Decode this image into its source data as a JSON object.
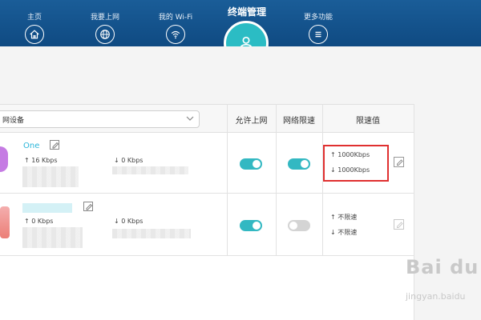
{
  "nav": {
    "items": [
      {
        "label": "主页",
        "icon": "home-icon"
      },
      {
        "label": "我要上网",
        "icon": "globe-icon"
      },
      {
        "label": "我的 Wi-Fi",
        "icon": "wifi-icon"
      },
      {
        "label": "终端管理",
        "icon": "user-icon",
        "active": true
      },
      {
        "label": "更多功能",
        "icon": "menu-icon"
      }
    ],
    "active_color": "#2bbcc4",
    "bar_color": "#1a5d98"
  },
  "table": {
    "filter_value": "网设备",
    "headers": {
      "allow": "允许上网",
      "limit": "网络限速",
      "limit_value": "限速值"
    },
    "rows": [
      {
        "name": "One",
        "up_speed": "↑ 16 Kbps",
        "down_speed": "↓ 0 Kbps",
        "allow_internet": true,
        "speed_limit": true,
        "up_limit": "↑ 1000Kbps",
        "down_limit": "↓ 1000Kbps",
        "highlighted": true
      },
      {
        "name": "",
        "up_speed": "↑ 0 Kbps",
        "down_speed": "↓ 0 Kbps",
        "allow_internet": true,
        "speed_limit": false,
        "up_limit": "↑ 不限速",
        "down_limit": "↓ 不限速",
        "highlighted": false
      }
    ]
  },
  "watermark": {
    "main": "Bai du",
    "sub": "jingyan.baidu"
  }
}
